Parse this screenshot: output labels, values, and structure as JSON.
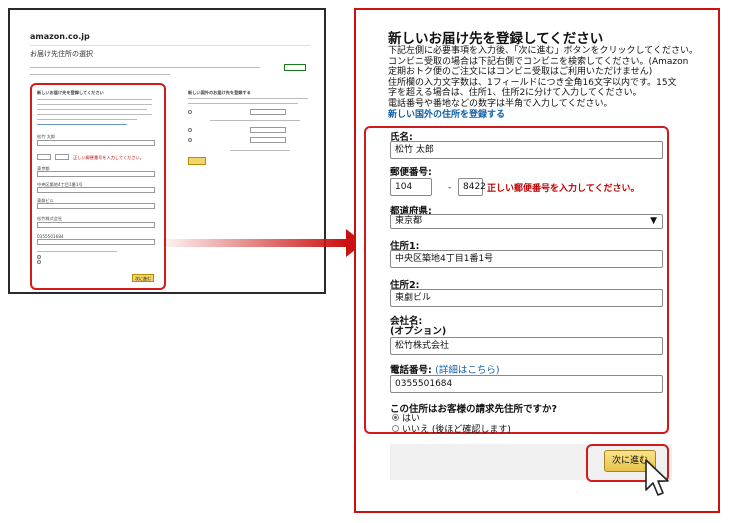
{
  "thumbnail": {
    "logo": "amazon.co.jp",
    "page_title": "お届け先住所の選択",
    "form_heading": "新しいお届け先を登録してください",
    "intl_heading": "新しい国外のお届け先を登録する",
    "name_value": "松竹 太郎",
    "zip_first": "104",
    "zip_second": "8422",
    "zip_error": "正しい郵便番号を入力してください。",
    "prefecture": "東京都",
    "address1": "中央区築地4丁目1番1号",
    "address2": "東劇ビル",
    "company": "松竹株式会社",
    "phone": "0355501684",
    "next_label": "次に進む"
  },
  "panel": {
    "title": "新しいお届け先を登録してください",
    "instructions": [
      "下記左側に必要事項を入力後、「次に進む」ボタンをクリックしてください。",
      "コンビニ受取の場合は下記右側でコンビニを検索してください。(Amazon",
      "定期おトク便のご注文にはコンビニ受取はご利用いただけません)",
      "住所欄の入力文字数は、1フィールドにつき全角16文字以内です。15文",
      "字を超える場合は、住所1、住所2に分けて入力してください。",
      "電話番号や番地などの数字は半角で入力してください。"
    ],
    "intl_link": "新しい国外の住所を登録する"
  },
  "form": {
    "name_label": "氏名:",
    "name_value": "松竹 太郎",
    "zip_label": "郵便番号:",
    "zip_first": "104",
    "zip_dash": "-",
    "zip_second": "8422",
    "zip_error": "正しい郵便番号を入力してください。",
    "pref_label": "都道府県:",
    "pref_value": "東京都",
    "address1_label": "住所1:",
    "address1_value": "中央区築地4丁目1番1号",
    "address2_label": "住所2:",
    "address2_value": "東劇ビル",
    "company_label": "会社名:",
    "company_optional": "(オプション)",
    "company_value": "松竹株式会社",
    "phone_label": "電話番号:",
    "phone_help": "(詳細はこちら)",
    "phone_value": "0355501684",
    "billing_question": "この住所はお客様の請求先住所ですか?",
    "billing_yes": "はい",
    "billing_no": "いいえ (後ほど確認します)",
    "next_label": "次に進む"
  },
  "colors": {
    "highlight_red": "#d11a1a",
    "link_blue": "#0d5fa5",
    "button_yellow": "#f3d46b"
  },
  "icons": {
    "arrow": "right-arrow-icon",
    "cursor": "mouse-pointer-icon",
    "dropdown": "dropdown-arrow-icon"
  }
}
